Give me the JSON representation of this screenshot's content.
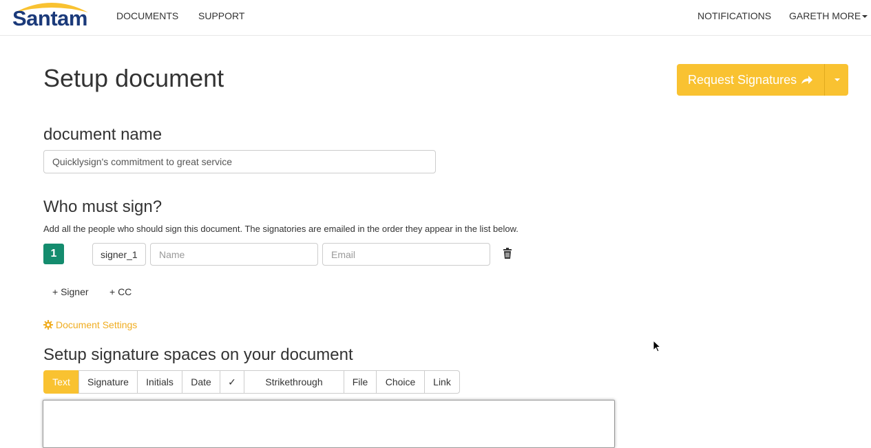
{
  "brand": {
    "name": "Santam",
    "primary_color": "#1b3a7a",
    "accent_color": "#f9c231"
  },
  "nav": {
    "left": [
      "DOCUMENTS",
      "SUPPORT"
    ],
    "notifications": "NOTIFICATIONS",
    "user": "GARETH MORE"
  },
  "page": {
    "title": "Setup document",
    "request_button": {
      "label": "Request Signatures",
      "icon": "share-arrow-icon"
    },
    "doc_name_heading": "document name",
    "doc_name_value": "Quicklysign's commitment to great service",
    "who_heading": "Who must sign?",
    "who_help": "Add all the people who should sign this document. The signatories are emailed in the order they appear in the list below.",
    "signer": {
      "number": "1",
      "role": "signer_1",
      "name_placeholder": "Name",
      "email_placeholder": "Email"
    },
    "add_signer": "+ Signer",
    "add_cc": "+ CC",
    "settings_link": "Document Settings",
    "spaces_heading": "Setup signature spaces on your document",
    "tools": [
      "Text",
      "Signature",
      "Initials",
      "Date",
      "✓",
      "Strikethrough",
      "File",
      "Choice",
      "Link"
    ],
    "active_tool": "Text"
  }
}
